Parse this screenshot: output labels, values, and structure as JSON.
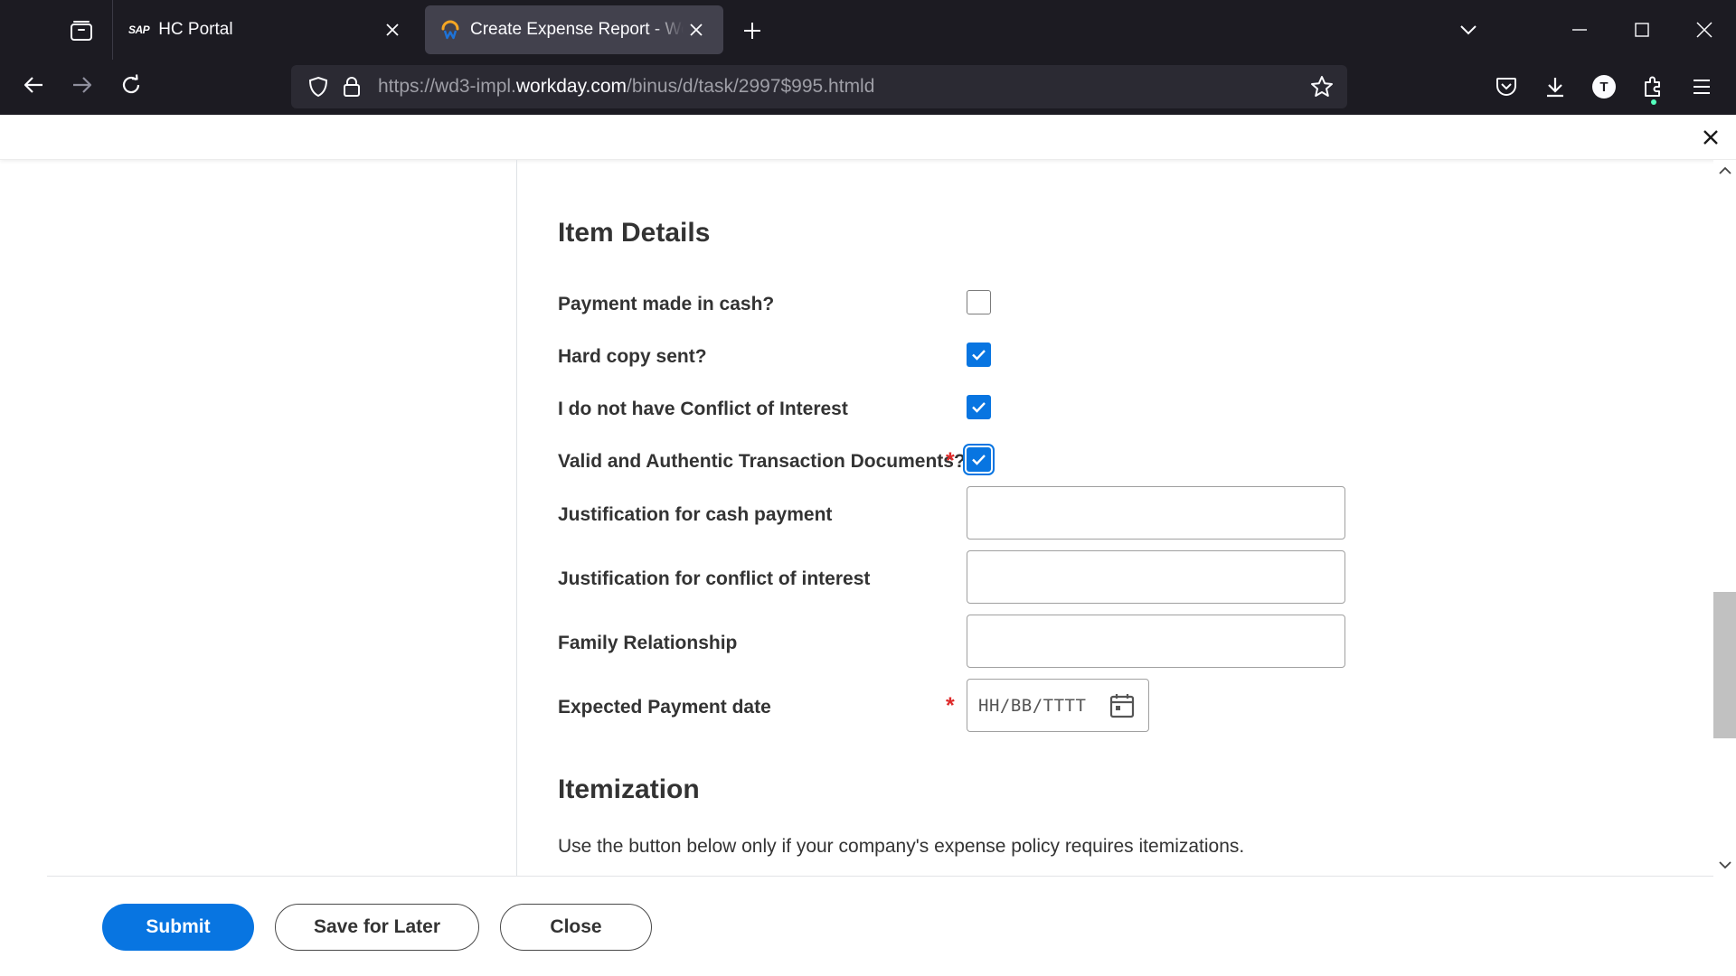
{
  "browser": {
    "tabs": [
      {
        "label": "HC Portal",
        "favicon": "sap-logo-icon",
        "favicon_text": "SAP",
        "active": false
      },
      {
        "label": "Create Expense Report - Workday",
        "favicon": "workday-logo-icon",
        "active": true
      }
    ],
    "url": {
      "prefix": "https://wd3-impl.",
      "host": "workday.com",
      "path": "/binus/d/task/2997$995.htmld"
    },
    "profile_initial": "T"
  },
  "item_details": {
    "title": "Item Details",
    "checkboxes": [
      {
        "label": "Payment made in cash?",
        "checked": false,
        "required": false
      },
      {
        "label": "Hard copy sent?",
        "checked": true,
        "required": false
      },
      {
        "label": "I do not have Conflict of Interest",
        "checked": true,
        "required": false
      },
      {
        "label": "Valid and Authentic Transaction Documents?",
        "checked": true,
        "required": true
      }
    ],
    "text_fields": [
      {
        "label": "Justification for cash payment",
        "value": ""
      },
      {
        "label": "Justification for conflict of interest",
        "value": ""
      },
      {
        "label": "Family Relationship",
        "value": ""
      }
    ],
    "date_field": {
      "label": "Expected Payment date",
      "placeholder": "HH/BB/TTTT",
      "required": true
    },
    "required_marker": "*"
  },
  "itemization": {
    "title": "Itemization",
    "help_text": "Use the button below only if your company's expense policy requires itemizations."
  },
  "footer": {
    "submit_label": "Submit",
    "save_label": "Save for Later",
    "close_label": "Close"
  },
  "colors": {
    "primary": "#0875e1",
    "required": "#de2a2a",
    "chrome_bg": "#1c1b22"
  }
}
